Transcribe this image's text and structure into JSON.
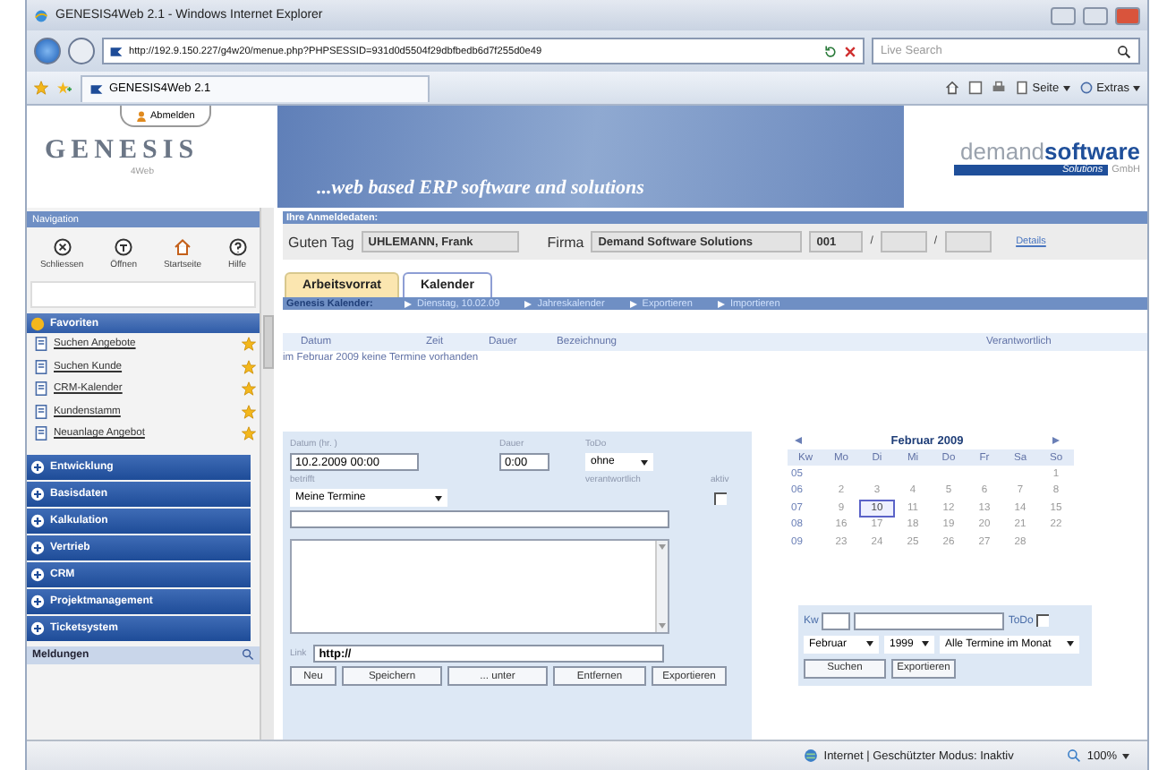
{
  "window": {
    "title": "GENESIS4Web 2.1 - Windows Internet Explorer"
  },
  "address_bar": {
    "url": "http://192.9.150.227/g4w20/menue.php?PHPSESSID=931d0d5504f29dbfbedb6d7f255d0e49",
    "search_placeholder": "Live Search"
  },
  "browser_tab": {
    "label": "GENESIS4Web 2.1"
  },
  "toolbar": [
    "Seite",
    "Extras"
  ],
  "header": {
    "logo": "GENESIS",
    "logo_sub": "4Web",
    "logout": "Abmelden",
    "slogan": "...web based ERP software and solutions",
    "brand_light": "demand",
    "brand_bold": "software",
    "brand_tag": "Solutions",
    "brand_suffix": "GmbH"
  },
  "sidebar": {
    "title": "Navigation",
    "tools": [
      {
        "label": "Schliessen",
        "kind": "close"
      },
      {
        "label": "Öffnen",
        "kind": "open"
      },
      {
        "label": "Startseite",
        "kind": "home"
      },
      {
        "label": "Hilfe",
        "kind": "help"
      }
    ],
    "favorites_title": "Favoriten",
    "favorites": [
      "Suchen Angebote",
      "Suchen Kunde",
      "CRM-Kalender",
      "Kundenstamm",
      "Neuanlage Angebot"
    ],
    "modules": [
      "Entwicklung",
      "Basisdaten",
      "Kalkulation",
      "Vertrieb",
      "CRM",
      "Projektmanagement",
      "Ticketsystem"
    ],
    "messages_title": "Meldungen"
  },
  "login": {
    "title": "Ihre Anmeldedaten:",
    "greeting": "Guten Tag",
    "user": "UHLEMANN, Frank",
    "company_label": "Firma",
    "company": "Demand Software Solutions",
    "number": "001",
    "separator": "/",
    "details": "Details"
  },
  "tabs": [
    {
      "label": "Arbeitsvorrat",
      "selected": false
    },
    {
      "label": "Kalender",
      "selected": true
    }
  ],
  "calendar_bar": {
    "title": "Genesis Kalender:",
    "links": [
      "Dienstag, 10.02.09",
      "Jahreskalender",
      "Exportieren",
      "Importieren"
    ]
  },
  "table": {
    "columns": [
      "Datum",
      "Zeit",
      "Dauer",
      "Bezeichnung",
      "Verantwortlich"
    ],
    "message": "im Februar 2009 keine Termine vorhanden"
  },
  "form": {
    "date_label": "Datum (hr. )",
    "duration_label": "Dauer",
    "todo_label": "ToDo",
    "date": "10.2.2009 00:00",
    "duration": "0:00",
    "todo": "ohne",
    "subject_label": "betrifft",
    "responsible_label": "verantwortlich",
    "active_label": "aktiv",
    "active": false,
    "subject": "Meine Termine",
    "link_label": "Link",
    "link": "http://",
    "buttons": [
      "Neu",
      "Speichern",
      "... unter",
      "Entfernen",
      "Exportieren"
    ]
  },
  "month": {
    "title": "Februar 2009",
    "columns": [
      "Kw",
      "Mo",
      "Di",
      "Mi",
      "Do",
      "Fr",
      "Sa",
      "So"
    ],
    "weeks": [
      {
        "kw": "05",
        "days": [
          {
            "d": "1",
            "selected": false
          }
        ]
      },
      {
        "kw": "06",
        "days": [
          {
            "d": "2",
            "selected": false
          },
          {
            "d": "3",
            "selected": false
          },
          {
            "d": "4",
            "selected": false
          },
          {
            "d": "5",
            "selected": false
          },
          {
            "d": "6",
            "selected": false
          },
          {
            "d": "7",
            "selected": false
          },
          {
            "d": "8",
            "selected": false
          }
        ]
      },
      {
        "kw": "07",
        "days": [
          {
            "d": "9",
            "selected": false
          },
          {
            "d": "10",
            "selected": true
          },
          {
            "d": "11",
            "selected": false
          },
          {
            "d": "12",
            "selected": false
          },
          {
            "d": "13",
            "selected": false
          },
          {
            "d": "14",
            "selected": false
          },
          {
            "d": "15",
            "selected": false
          }
        ]
      },
      {
        "kw": "08",
        "days": [
          {
            "d": "16",
            "selected": false
          },
          {
            "d": "17",
            "selected": false
          },
          {
            "d": "18",
            "selected": false
          },
          {
            "d": "19",
            "selected": false
          },
          {
            "d": "20",
            "selected": false
          },
          {
            "d": "21",
            "selected": false
          },
          {
            "d": "22",
            "selected": false
          }
        ]
      },
      {
        "kw": "09",
        "days": [
          {
            "d": "23",
            "selected": false
          },
          {
            "d": "24",
            "selected": false
          },
          {
            "d": "25",
            "selected": false
          },
          {
            "d": "26",
            "selected": false
          },
          {
            "d": "27",
            "selected": false
          },
          {
            "d": "28",
            "selected": false
          }
        ]
      }
    ]
  },
  "search": {
    "kw_label": "Kw",
    "todo_label": "ToDo",
    "todo": false,
    "month": "Februar",
    "year": "1999",
    "filter": "Alle Termine im Monat",
    "buttons": [
      "Suchen",
      "Exportieren"
    ]
  },
  "status_bar": {
    "text": "Internet | Geschützter Modus: Inaktiv",
    "zoom": "100%"
  }
}
